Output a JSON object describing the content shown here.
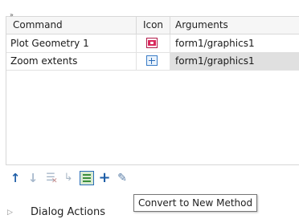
{
  "table": {
    "sort_indicator": "»",
    "headers": {
      "command": "Command",
      "icon": "Icon",
      "arguments": "Arguments"
    },
    "rows": [
      {
        "command": "Plot Geometry 1",
        "icon": "plot-geometry-icon",
        "arguments": "form1/graphics1"
      },
      {
        "command": "Zoom extents",
        "icon": "zoom-extents-icon",
        "arguments": "form1/graphics1"
      }
    ]
  },
  "toolbar": {
    "buttons": [
      {
        "icon": "move-up-icon",
        "glyph": "↑"
      },
      {
        "icon": "move-down-icon",
        "glyph": "↓"
      },
      {
        "icon": "delete-icon",
        "glyph": "☰"
      },
      {
        "icon": "method-icon",
        "glyph": "↳"
      },
      {
        "icon": "convert-to-new-method-icon"
      },
      {
        "icon": "add-icon",
        "glyph": "+"
      },
      {
        "icon": "edit-icon",
        "glyph": "✎"
      }
    ]
  },
  "tooltip": {
    "text": "Convert to New Method"
  },
  "section": {
    "arrow": "▷",
    "label": "Dialog Actions"
  }
}
